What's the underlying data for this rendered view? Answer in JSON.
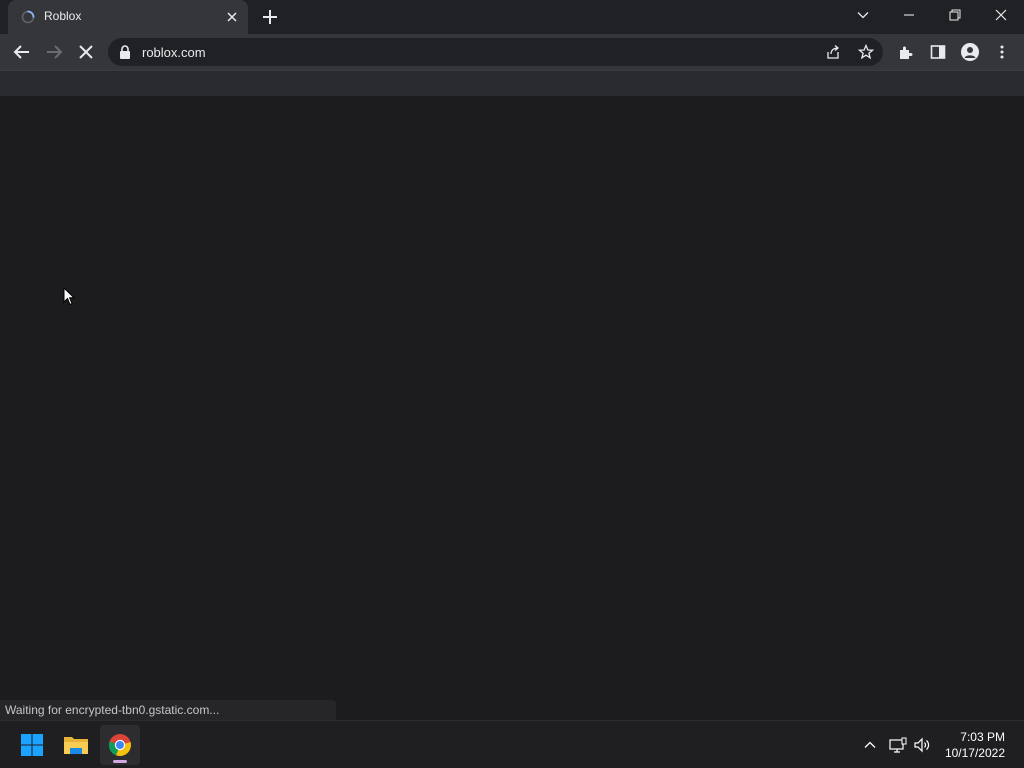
{
  "tab": {
    "title": "Roblox"
  },
  "omnibox": {
    "url": "roblox.com"
  },
  "status": {
    "text": "Waiting for encrypted-tbn0.gstatic.com..."
  },
  "clock": {
    "time": "7:03 PM",
    "date": "10/17/2022"
  },
  "colors": {
    "accent": "#8ab4f8",
    "tab_bg": "#35363a",
    "page_bg": "#1c1c1e",
    "windows_blue": "#1aa3ff"
  },
  "icons": [
    "loading-spinner-icon",
    "close-icon",
    "plus-icon",
    "chevron-down-icon",
    "minimize-icon",
    "restore-icon",
    "back-arrow-icon",
    "forward-arrow-icon",
    "stop-icon",
    "lock-icon",
    "share-icon",
    "star-icon",
    "extensions-icon",
    "side-panel-icon",
    "profile-icon",
    "more-icon",
    "windows-start-icon",
    "file-explorer-icon",
    "chrome-icon",
    "chevron-up-icon",
    "network-icon",
    "volume-icon",
    "mouse-cursor-icon"
  ]
}
